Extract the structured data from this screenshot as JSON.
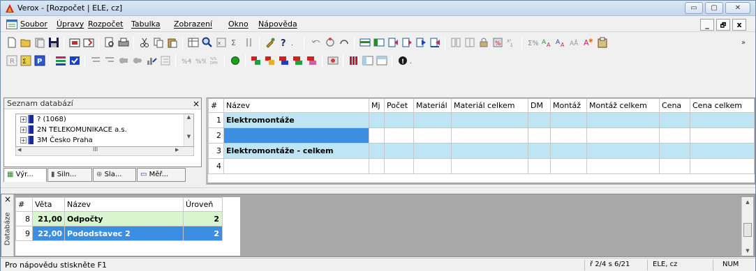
{
  "window": {
    "title": "Verox - [Rozpočet | ELE, cz]",
    "min_glyph": "▭",
    "max_glyph": "▢",
    "close_glyph": "✕"
  },
  "menu": {
    "items": [
      "Soubor",
      "Úpravy",
      "Rozpočet",
      "Tabulka",
      "Zobrazení",
      "Okno",
      "Nápověda"
    ],
    "mdi_min": "_",
    "mdi_restore": "🗗",
    "mdi_close": "x"
  },
  "database_panel": {
    "title": "Seznam databází",
    "close": "×",
    "tree": [
      {
        "label": "? (1068)",
        "color": "#1a2a9a"
      },
      {
        "label": "2N TELEKOMUNIKACE a.s.",
        "color": "#1a2a9a"
      },
      {
        "label": "3M Česko Praha",
        "color": "#1a2a9a"
      }
    ],
    "scroll_grip": "III",
    "tabs": [
      "Výr...",
      "Siln...",
      "Sla...",
      "Měř..."
    ]
  },
  "grid": {
    "columns": [
      "#",
      "Název",
      "Mj",
      "Počet",
      "Materiál",
      "Materiál celkem",
      "DM",
      "Montáž",
      "Montáž celkem",
      "Cena",
      "Cena celkem"
    ],
    "rows": [
      {
        "num": "1",
        "name": "Elektromontáže",
        "style": "cyan"
      },
      {
        "num": "2",
        "name": "",
        "style": "selected"
      },
      {
        "num": "3",
        "name": "Elektromontáže - celkem",
        "style": "cyan"
      },
      {
        "num": "4",
        "name": "",
        "style": "blank"
      }
    ]
  },
  "bottom_panel": {
    "side_label": "Databáze",
    "close": "×",
    "columns": [
      "#",
      "Věta",
      "Název",
      "Úroveň"
    ],
    "rows": [
      {
        "num": "8",
        "veta": "21,00",
        "name": "Odpočty",
        "level": "2",
        "style": "green"
      },
      {
        "num": "9",
        "veta": "22,00",
        "name": "Pododstavec 2",
        "level": "2",
        "style": "selected"
      }
    ]
  },
  "status": {
    "help": "Pro nápovědu stiskněte F1",
    "position": "ř 2/4 s 6/21",
    "locale": "ELE, cz",
    "numlock": "NUM"
  },
  "colors": {
    "accent_selection": "#3c8fe0",
    "row_cyan": "#bde5f4",
    "row_green": "#d8f5cf",
    "gray_area": "#a8a8a8"
  }
}
